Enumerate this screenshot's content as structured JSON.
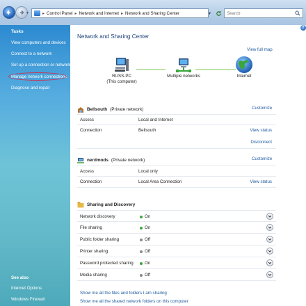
{
  "address_bar": {
    "breadcrumb": [
      "Control Panel",
      "Network and Internet",
      "Network and Sharing Center"
    ],
    "search_placeholder": "Search"
  },
  "tasks": {
    "title": "Tasks",
    "items": [
      "View computers and devices",
      "Connect to a network",
      "Set up a connection or network",
      "Manage network connections",
      "Diagnose and repair"
    ],
    "see_also_title": "See also",
    "see_also": [
      "Internet Options",
      "Windows Firewall"
    ]
  },
  "main": {
    "title": "Network and Sharing Center",
    "view_full_map": "View full map",
    "map_nodes": [
      {
        "label": "RUSS-PC",
        "sublabel": "(This computer)",
        "icon": "computer-icon"
      },
      {
        "label": "Multiple networks",
        "sublabel": "",
        "icon": "network-icon"
      },
      {
        "label": "Internet",
        "sublabel": "",
        "icon": "globe-icon"
      }
    ],
    "networks": [
      {
        "name": "Bellsouth",
        "type": "(Private network)",
        "customize": "Customize",
        "rows": [
          {
            "key": "Access",
            "value": "Local and Internet",
            "link": ""
          },
          {
            "key": "Connection",
            "value": "Bellsouth",
            "link": "View status",
            "link2": "Disconnect"
          }
        ]
      },
      {
        "name": "nerdmods",
        "type": "(Private network)",
        "customize": "Customize",
        "rows": [
          {
            "key": "Access",
            "value": "Local only",
            "link": ""
          },
          {
            "key": "Connection",
            "value": "Local Area Connection",
            "link": "View status"
          }
        ]
      }
    ],
    "sharing": {
      "title": "Sharing and Discovery",
      "items": [
        {
          "label": "Network discovery",
          "state": "On",
          "color": "#3aa63a"
        },
        {
          "label": "File sharing",
          "state": "On",
          "color": "#3aa63a"
        },
        {
          "label": "Public folder sharing",
          "state": "Off",
          "color": "#8a8a8a"
        },
        {
          "label": "Printer sharing",
          "state": "Off",
          "color": "#8a8a8a"
        },
        {
          "label": "Password protected sharing",
          "state": "On",
          "color": "#3aa63a"
        },
        {
          "label": "Media sharing",
          "state": "Off",
          "color": "#8a8a8a"
        }
      ]
    },
    "bottom_links": [
      "Show me all the files and folders I am sharing",
      "Show me all the shared network folders on this computer"
    ]
  },
  "colors": {
    "link": "#1e5a9e",
    "title": "#1e3f7a",
    "tasks_pane": "#4da9d8",
    "highlight_ring": "#c63a5a"
  }
}
